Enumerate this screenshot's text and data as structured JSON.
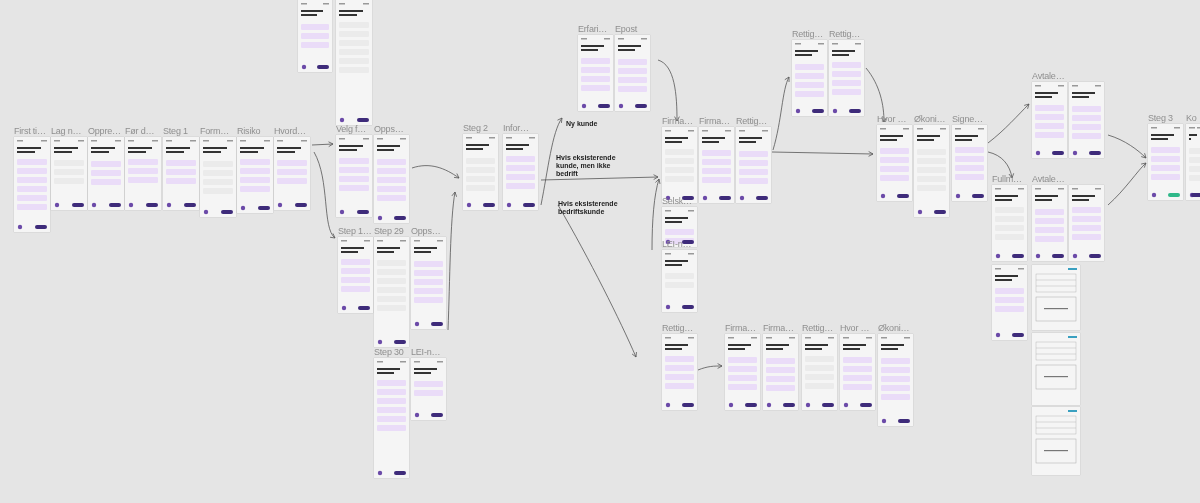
{
  "canvas": {
    "frames": [
      {
        "label": "First ti…",
        "kind": "phone"
      },
      {
        "label": "Lag n…",
        "kind": "phone"
      },
      {
        "label": "Oppre…",
        "kind": "phone"
      },
      {
        "label": "Før d…",
        "kind": "phone"
      },
      {
        "label": "Steg 1",
        "kind": "phone"
      },
      {
        "label": "Form…",
        "kind": "phone"
      },
      {
        "label": "Risiko",
        "kind": "phone"
      },
      {
        "label": "Hvord…",
        "kind": "phone"
      },
      {
        "kind": "phone"
      },
      {
        "kind": "phone"
      },
      {
        "label": "Velg f…",
        "kind": "phone"
      },
      {
        "label": "Opps…",
        "kind": "phone"
      },
      {
        "label": "Step 1…",
        "kind": "phone"
      },
      {
        "label": "Step 29",
        "kind": "phone"
      },
      {
        "label": "Opps…",
        "kind": "phone"
      },
      {
        "label": "Step 30",
        "kind": "phone"
      },
      {
        "label": "LEI-n…",
        "kind": "phone"
      },
      {
        "label": "Steg 2",
        "kind": "phone"
      },
      {
        "label": "Infor…",
        "kind": "phone"
      },
      {
        "label": "Erfari…",
        "kind": "phone"
      },
      {
        "label": "Epost",
        "kind": "phone"
      },
      {
        "label": "Firma…",
        "kind": "phone"
      },
      {
        "label": "Firma…",
        "kind": "phone"
      },
      {
        "label": "Rettig…",
        "kind": "phone"
      },
      {
        "label": "Selsk…",
        "kind": "phone"
      },
      {
        "label": "LEI-n…",
        "kind": "phone"
      },
      {
        "label": "Rettig…",
        "kind": "phone"
      },
      {
        "label": "Rettig…",
        "kind": "phone"
      },
      {
        "label": "Hvor …",
        "kind": "phone"
      },
      {
        "label": "Økoni…",
        "kind": "phone"
      },
      {
        "label": "Signe…",
        "kind": "phone"
      },
      {
        "label": "Avtale…",
        "kind": "phone"
      },
      {
        "kind": "phone"
      },
      {
        "label": "Fullm…",
        "kind": "phone"
      },
      {
        "kind": "phone"
      },
      {
        "label": "Avtale…",
        "kind": "phone"
      },
      {
        "kind": "phone"
      },
      {
        "kind": "document"
      },
      {
        "kind": "document"
      },
      {
        "kind": "document"
      },
      {
        "label": "Steg 3",
        "kind": "phone"
      },
      {
        "label": "Ko",
        "kind": "phone"
      },
      {
        "label": "Rettig…",
        "kind": "phone"
      },
      {
        "label": "Firma…",
        "kind": "phone"
      },
      {
        "label": "Firma…",
        "kind": "phone"
      },
      {
        "label": "Rettig…",
        "kind": "phone"
      },
      {
        "label": "Hvor …",
        "kind": "phone"
      },
      {
        "label": "Økoni…",
        "kind": "phone"
      }
    ],
    "annotations": [
      {
        "text": "Ny kunde"
      },
      {
        "text": "Hvis eksisterende kunde, men ikke bedrift"
      },
      {
        "text": "Hvis eksisterende bedriftskunde"
      }
    ]
  }
}
